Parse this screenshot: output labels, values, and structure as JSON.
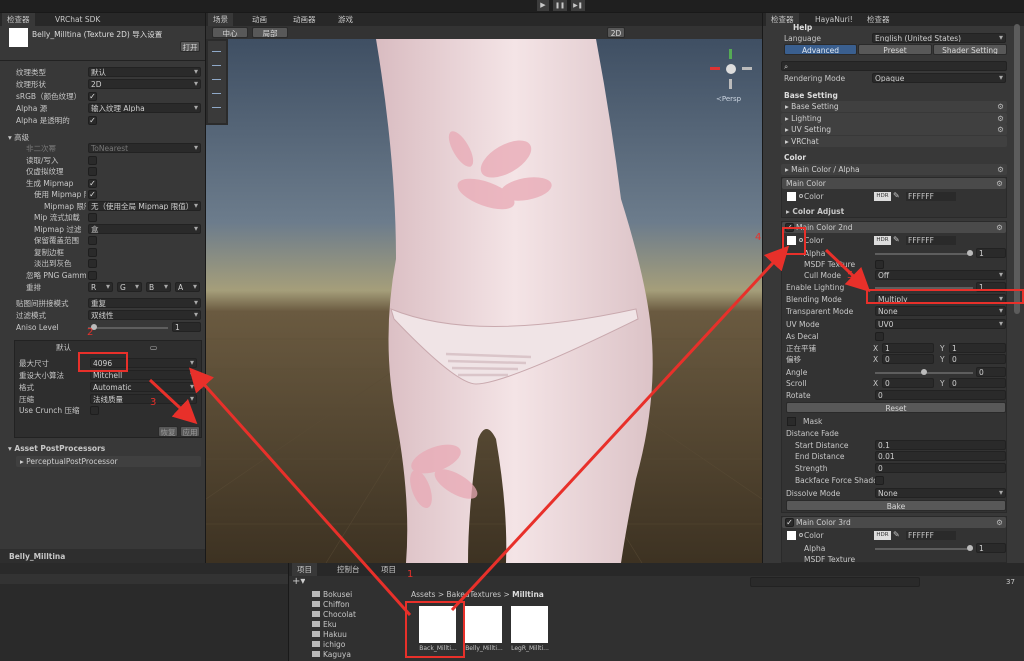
{
  "toolbar": {
    "play": "▶",
    "pause": "❚❚",
    "step": "▶❚"
  },
  "left": {
    "tabs": [
      "检查器",
      "VRChat SDK"
    ],
    "asset_title": "Belly_Milltina (Texture 2D) 导入设置",
    "open_btn": "打开",
    "props": [
      {
        "label": "纹理类型",
        "value": "默认"
      },
      {
        "label": "纹理形状",
        "value": "2D"
      },
      {
        "label": "sRGB（颜色纹理）",
        "value": "✓"
      },
      {
        "label": "Alpha 源",
        "value": "输入纹理 Alpha"
      },
      {
        "label": "Alpha 是透明的",
        "value": "✓"
      }
    ],
    "advanced": "高级",
    "adv_props": [
      {
        "label": "非二次幂",
        "value": "ToNearest"
      },
      {
        "label": "读取/写入",
        "value": ""
      },
      {
        "label": "仅虚拟纹理",
        "value": ""
      },
      {
        "label": "生成 Mipmap",
        "value": "✓"
      },
      {
        "label": "使用 Mipmap 限制",
        "value": "✓"
      },
      {
        "label": "Mipmap 限制组",
        "value": "无（使用全局 Mipmap 限值）"
      },
      {
        "label": "Mip 流式加载",
        "value": ""
      },
      {
        "label": "Mipmap 过滤",
        "value": "盒"
      },
      {
        "label": "保留覆盖范围",
        "value": ""
      },
      {
        "label": "复制边框",
        "value": ""
      },
      {
        "label": "淡出到灰色",
        "value": ""
      },
      {
        "label": "忽略 PNG Gamma",
        "value": ""
      }
    ],
    "swizzle_label": "重排",
    "swizzle": [
      "R",
      "G",
      "B",
      "A"
    ],
    "wrap_label": "贴图间拼接模式",
    "wrap_value": "重复",
    "filter_label": "过滤模式",
    "filter_value": "双线性",
    "aniso_label": "Aniso Level",
    "aniso_value": "1",
    "platform_default": "默认",
    "max_size_label": "最大尺寸",
    "max_size_value": "4096",
    "resize_label": "重设大小算法",
    "resize_value": "Mitchell",
    "format_label": "格式",
    "format_value": "Automatic",
    "compression_label": "压缩",
    "compression_value": "法线质量",
    "crunch_label": "Use Crunch 压缩",
    "revert_btn": "恢复",
    "apply_btn": "应用",
    "postprocessors_title": "Asset PostProcessors",
    "postprocessor_item": "PerceptualPostProcessor",
    "footer_name": "Belly_Milltina"
  },
  "scene": {
    "tabs": [
      "场景",
      "动画",
      "动画器",
      "游戏"
    ],
    "center_btn": "中心",
    "local_btn": "局部",
    "mode_2d": "2D",
    "persp": "≺Persp"
  },
  "right": {
    "tabs": [
      "检查器",
      "HayaNuri!",
      "检查器"
    ],
    "help": "Help",
    "language_label": "Language",
    "language_value": "English (United States)",
    "mode_tabs": [
      "Advanced",
      "Preset",
      "Shader Setting"
    ],
    "rendering_mode_label": "Rendering Mode",
    "rendering_mode_value": "Opaque",
    "base_setting": "Base Setting",
    "base_items": [
      "Base Setting",
      "Lighting",
      "UV Setting",
      "VRChat"
    ],
    "color_title": "Color",
    "main_color_alpha": "Main Color / Alpha",
    "main_color": "Main Color",
    "color_label": "Color",
    "hdr": "HDR",
    "hex": "FFFFFF",
    "color_adjust": "Color Adjust",
    "main_color_2nd": "Main Color 2nd",
    "alpha_label": "Alpha",
    "alpha_value": "1",
    "msdf_label": "MSDF Texture",
    "cull_label": "Cull Mode",
    "cull_value": "Off",
    "enable_lighting_label": "Enable Lighting",
    "enable_lighting_value": "1",
    "blending_label": "Blending Mode",
    "blending_value": "Multiply",
    "transparent_label": "Transparent Mode",
    "transparent_value": "None",
    "uv_mode_label": "UV Mode",
    "uv_mode_value": "UV0",
    "as_decal_label": "As Decal",
    "tiling_label": "正在平铺",
    "offset_label": "偏移",
    "x": "X",
    "y": "Y",
    "tiling_x": "1",
    "tiling_y": "1",
    "offset_x": "0",
    "offset_y": "0",
    "angle_label": "Angle",
    "angle_value": "0",
    "scroll_label": "Scroll",
    "scroll_x": "0",
    "scroll_y": "0",
    "rotate_label": "Rotate",
    "rotate_value": "0",
    "reset_btn": "Reset",
    "mask_label": "Mask",
    "distance_fade": "Distance Fade",
    "start_distance_label": "Start Distance",
    "start_distance_value": "0.1",
    "end_distance_label": "End Distance",
    "end_distance_value": "0.01",
    "strength_label": "Strength",
    "strength_value": "0",
    "backface_label": "Backface Force Shadow",
    "dissolve_label": "Dissolve Mode",
    "dissolve_value": "None",
    "bake_btn": "Bake",
    "main_color_3rd": "Main Color 3rd",
    "alpha3_value": "1"
  },
  "bottom": {
    "tabs": [
      "项目",
      "控制台",
      "项目"
    ],
    "breadcrumb": [
      "Assets",
      "BakedTextures",
      "Milltina"
    ],
    "folders": [
      "Bokusei",
      "Chiffon",
      "Chocolat",
      "Eku",
      "Hakuu",
      "ichigo",
      "Kaguya"
    ],
    "files": [
      "Back_Millti...",
      "Belly_Millti...",
      "LegR_Millti..."
    ],
    "count": "37"
  },
  "annotations": [
    "1",
    "2",
    "3",
    "4",
    "5"
  ],
  "colors": {
    "annotation_red": "#e8302a",
    "selected_blue": "#3a5f8f",
    "panel": "#383838"
  }
}
